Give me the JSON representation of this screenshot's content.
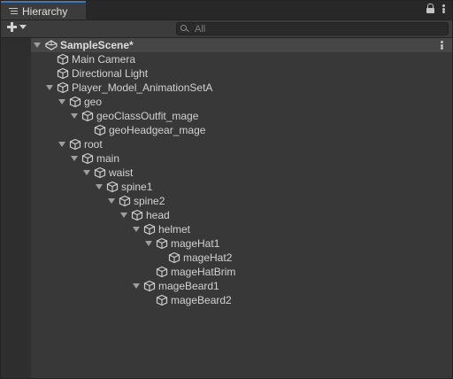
{
  "window": {
    "tab_title": "Hierarchy",
    "tab_icon": "hierarchy-list-icon",
    "lock_icon": "lock-icon",
    "menu_icon": "kebab-menu-icon"
  },
  "toolbar": {
    "add_icon": "plus-icon",
    "dropdown_icon": "chevron-down-icon",
    "search_placeholder": "All",
    "search_value": ""
  },
  "colors": {
    "background": "#383838",
    "gutter": "#2e2e2e",
    "scene_row": "#464646",
    "tab_accent": "#3a79bb",
    "text": "#d2d2d2"
  },
  "tree": {
    "scene": {
      "label": "SampleScene*",
      "icon": "unity-scene-icon",
      "expanded": true
    },
    "items": [
      {
        "label": "Main Camera",
        "depth": 1,
        "has_children": false,
        "expanded": false
      },
      {
        "label": "Directional Light",
        "depth": 1,
        "has_children": false,
        "expanded": false
      },
      {
        "label": "Player_Model_AnimationSetA",
        "depth": 1,
        "has_children": true,
        "expanded": true
      },
      {
        "label": "geo",
        "depth": 2,
        "has_children": true,
        "expanded": true
      },
      {
        "label": "geoClassOutfit_mage",
        "depth": 3,
        "has_children": true,
        "expanded": true
      },
      {
        "label": "geoHeadgear_mage",
        "depth": 4,
        "has_children": false,
        "expanded": false
      },
      {
        "label": "root",
        "depth": 2,
        "has_children": true,
        "expanded": true
      },
      {
        "label": "main",
        "depth": 3,
        "has_children": true,
        "expanded": true
      },
      {
        "label": "waist",
        "depth": 4,
        "has_children": true,
        "expanded": true
      },
      {
        "label": "spine1",
        "depth": 5,
        "has_children": true,
        "expanded": true
      },
      {
        "label": "spine2",
        "depth": 6,
        "has_children": true,
        "expanded": true
      },
      {
        "label": "head",
        "depth": 7,
        "has_children": true,
        "expanded": true
      },
      {
        "label": "helmet",
        "depth": 8,
        "has_children": true,
        "expanded": true
      },
      {
        "label": "mageHat1",
        "depth": 9,
        "has_children": true,
        "expanded": true
      },
      {
        "label": "mageHat2",
        "depth": 10,
        "has_children": false,
        "expanded": false
      },
      {
        "label": "mageHatBrim",
        "depth": 9,
        "has_children": false,
        "expanded": false
      },
      {
        "label": "mageBeard1",
        "depth": 8,
        "has_children": true,
        "expanded": true
      },
      {
        "label": "mageBeard2",
        "depth": 9,
        "has_children": false,
        "expanded": false
      }
    ],
    "item_icon": "gameobject-cube-icon"
  }
}
